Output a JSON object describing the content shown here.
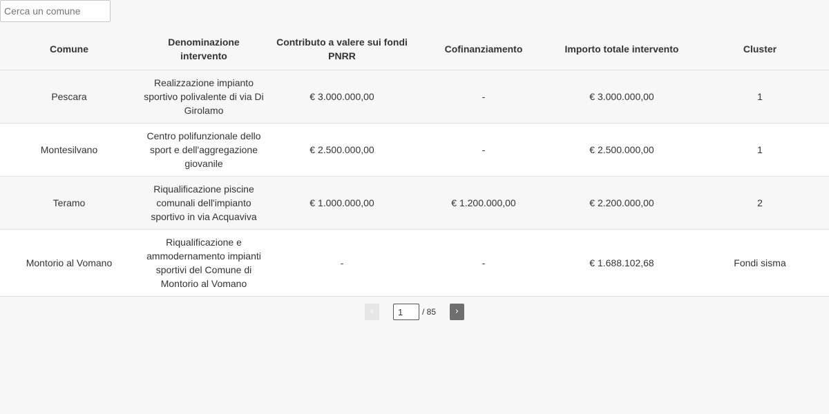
{
  "search": {
    "placeholder": "Cerca un comune",
    "value": ""
  },
  "table": {
    "headers": [
      "Comune",
      "Denominazione intervento",
      "Contributo a valere sui fondi PNRR",
      "Cofinanziamento",
      "Importo totale intervento",
      "Cluster"
    ],
    "rows": [
      {
        "comune": "Pescara",
        "denominazione": "Realizzazione impianto sportivo polivalente di via Di Girolamo",
        "contributo": "€ 3.000.000,00",
        "cofinanziamento": "-",
        "importo": "€ 3.000.000,00",
        "cluster": "1"
      },
      {
        "comune": "Montesilvano",
        "denominazione": "Centro polifunzionale dello sport e dell'aggregazione giovanile",
        "contributo": "€ 2.500.000,00",
        "cofinanziamento": "-",
        "importo": "€ 2.500.000,00",
        "cluster": "1"
      },
      {
        "comune": "Teramo",
        "denominazione": "Riqualificazione piscine comunali dell'impianto sportivo in via Acquaviva",
        "contributo": "€ 1.000.000,00",
        "cofinanziamento": "€ 1.200.000,00",
        "importo": "€ 2.200.000,00",
        "cluster": "2"
      },
      {
        "comune": "Montorio al Vomano",
        "denominazione": "Riqualificazione e ammodernamento impianti sportivi del Comune di Montorio al Vomano",
        "contributo": "-",
        "cofinanziamento": "-",
        "importo": "€ 1.688.102,68",
        "cluster": "Fondi sisma"
      }
    ]
  },
  "pager": {
    "prev_label": "‹",
    "next_label": "›",
    "current_page": "1",
    "total_label": "/ 85"
  }
}
